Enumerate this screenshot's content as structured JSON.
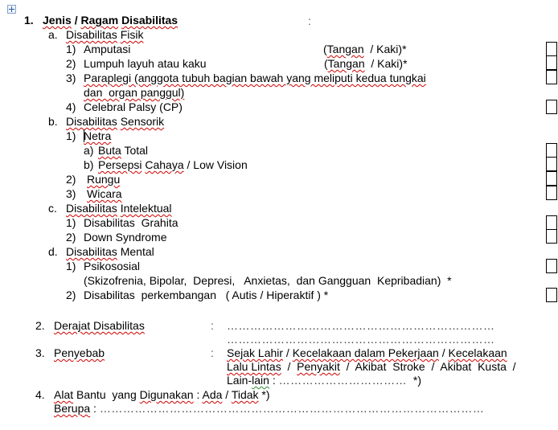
{
  "table_handle": "move-handle-icon",
  "section1": {
    "number": "1.",
    "title_parts": [
      "Jenis",
      " / ",
      "Ragam",
      " ",
      "Disabilitas"
    ],
    "colon": ":",
    "a": {
      "label": "a.",
      "title": [
        "Disabilitas",
        "Fisik"
      ],
      "items": [
        {
          "num": "1)",
          "text": "Amputasi",
          "note": [
            "(",
            "Tangan",
            "  / Kaki)*"
          ]
        },
        {
          "num": "2)",
          "text": "Lumpuh layuh atau kaku",
          "note": [
            "(",
            "Tangan",
            "  / Kaki)*"
          ]
        },
        {
          "num": "3)",
          "text_line1": "Paraplegi (anggota tubuh bagian bawah yang meliputi kedua tungkai",
          "text_line2": "dan  organ panggul)"
        },
        {
          "num": "4)",
          "text": "Celebral Palsy (CP)"
        }
      ]
    },
    "b": {
      "label": "b.",
      "title": [
        "Disabilitas",
        "Sensorik"
      ],
      "items": [
        {
          "num": "1)",
          "text": "Netra",
          "sub": [
            {
              "num": "a)",
              "text": [
                "Buta",
                " Total"
              ]
            },
            {
              "num": "b)",
              "text": [
                "Persepsi",
                " ",
                "Cahaya",
                " / Low Vision"
              ]
            }
          ]
        },
        {
          "num": "2)",
          "text": "Rungu"
        },
        {
          "num": "3)",
          "text": "Wicara"
        }
      ]
    },
    "c": {
      "label": "c.",
      "title": [
        "Disabilitas",
        "Intelektual"
      ],
      "items": [
        {
          "num": "1)",
          "text": "Disabilitas  Grahita"
        },
        {
          "num": "2)",
          "text": "Down Syndrome"
        }
      ]
    },
    "d": {
      "label": "d.",
      "title": [
        "Disabilitas",
        "Mental"
      ],
      "items": [
        {
          "num": "1)",
          "text": "Psikososial",
          "detail": "(Skizofrenia, Bipolar,  Depresi,   Anxietas,  dan Gangguan  Kepribadian)  *"
        },
        {
          "num": "2)",
          "text": "Disabilitas  perkembangan   ( Autis / Hiperaktif ) *"
        }
      ]
    }
  },
  "section2": {
    "number": "2.",
    "label": "Derajat Disabilitas",
    "colon": ":",
    "blank1": "……………………………………………………………",
    "blank2": "……………………………………………………………"
  },
  "section3": {
    "number": "3.",
    "label": "Penyebab",
    "colon": ":",
    "line1": [
      "Sejak Lahir",
      " / ",
      "Kecelakaan dalam Pekerjaan",
      " / ",
      "Kecelakaan"
    ],
    "line2": [
      "Lalu Lintas",
      "  /  ",
      "Penyakit",
      "  /  Akibat  Stroke  /  Akibat  Kusta  /"
    ],
    "line3": [
      "Lain-",
      "lain",
      " : ",
      "……………………………",
      "  *)"
    ]
  },
  "section4": {
    "number": "4.",
    "label_parts": [
      "Alat",
      " Bantu  yang ",
      "Digunakan",
      " : ",
      "Ada",
      " / ",
      "Tidak",
      " *)"
    ],
    "berupa": "Berupa",
    "berupa_colon": " : ",
    "blank": "………………………………………………………………………………………"
  },
  "checkboxes": {
    "amputasi": false,
    "lumpuh": false,
    "paraplegi": false,
    "celebral_palsy": false,
    "buta_total": false,
    "low_vision": false,
    "rungu": false,
    "wicara": false,
    "grahita": false,
    "down_syndrome": false,
    "psikososial": false,
    "perkembangan": false
  }
}
